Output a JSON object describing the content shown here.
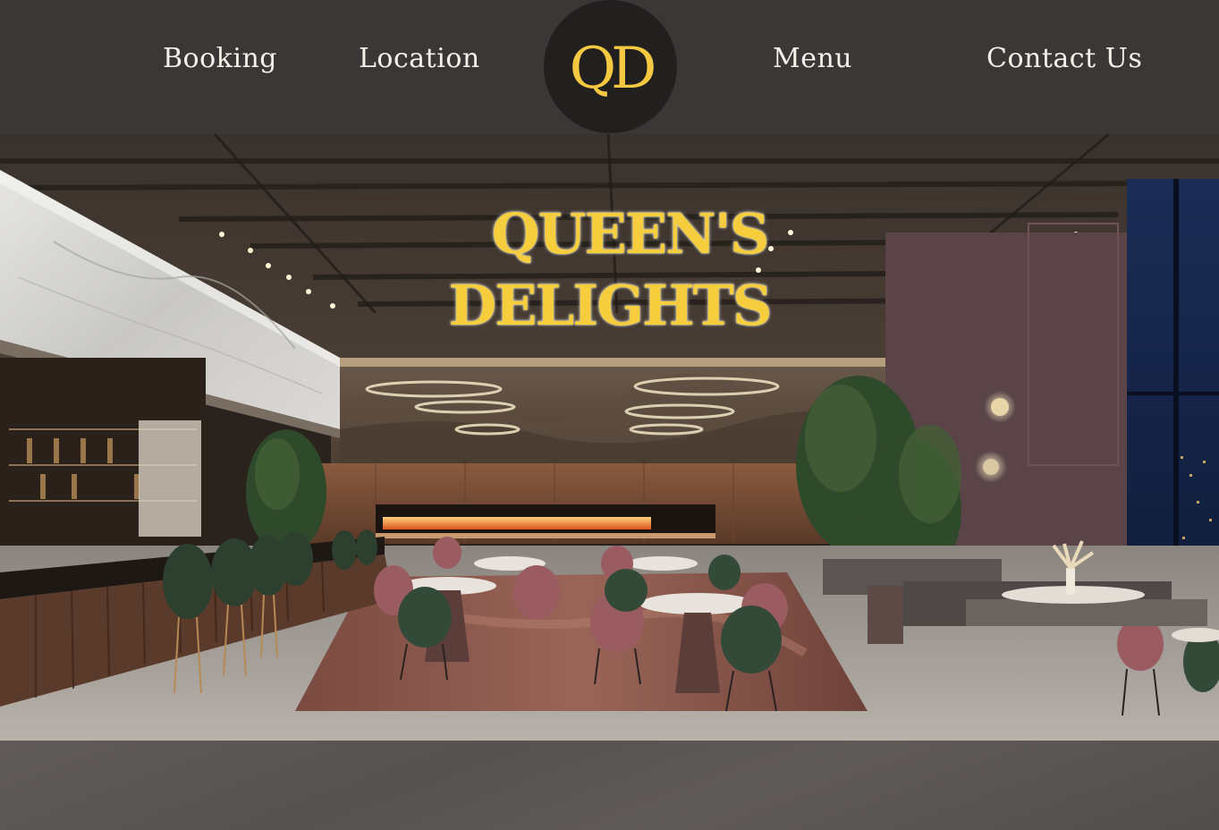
{
  "nav": {
    "booking": "Booking",
    "location": "Location",
    "menu": "Menu",
    "contact": "Contact Us"
  },
  "logo": {
    "text": "QD"
  },
  "hero": {
    "title_line1": "QUEEN'S",
    "title_line2": "DELIGHTS"
  },
  "colors": {
    "header_bg": "#3a3837",
    "logo_bg": "#221f1f",
    "accent_gold": "#f5c842",
    "nav_text": "#f4f1ea",
    "stone_band": "#5d5957"
  }
}
